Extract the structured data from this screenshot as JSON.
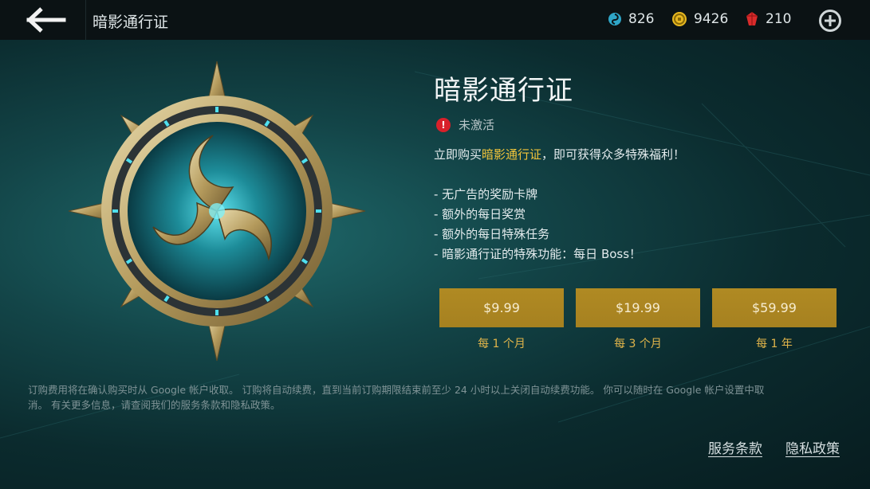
{
  "header": {
    "title": "暗影通行证",
    "back_icon": "arrow-left-icon",
    "currencies": [
      {
        "icon": "swirl-token-icon",
        "value": "826",
        "color": "#2fa6c8"
      },
      {
        "icon": "gold-coin-icon",
        "value": "9426",
        "color": "#e8b820"
      },
      {
        "icon": "red-gem-icon",
        "value": "210",
        "color": "#d92b2b"
      }
    ],
    "add_icon": "plus-circle-icon"
  },
  "pass": {
    "title": "暗影通行证",
    "status_text": "未激活",
    "intro_prefix": "立即购买",
    "intro_highlight": "暗影通行证",
    "intro_suffix": "，即可获得众多特殊福利！",
    "benefits": [
      "- 无广告的奖励卡牌",
      "- 额外的每日奖赏",
      "- 额外的每日特殊任务",
      "- 暗影通行证的特殊功能：每日 Boss！"
    ],
    "plans": [
      {
        "price": "$9.99",
        "period": "每 1 个月"
      },
      {
        "price": "$19.99",
        "period": "每 3 个月"
      },
      {
        "price": "$59.99",
        "period": "每 1 年"
      }
    ],
    "accent_color": "#a98420",
    "highlight_color": "#f2c43a"
  },
  "disclaimer": "订购费用将在确认购买时从 Google 帐户收取。 订购将自动续费，直到当前订购期限结束前至少 24 小时以上关闭自动续费功能。 你可以随时在 Google 帐户设置中取消。 有关更多信息，请查阅我们的服务条款和隐私政策。",
  "footer": {
    "terms": "服务条款",
    "privacy": "隐私政策"
  }
}
